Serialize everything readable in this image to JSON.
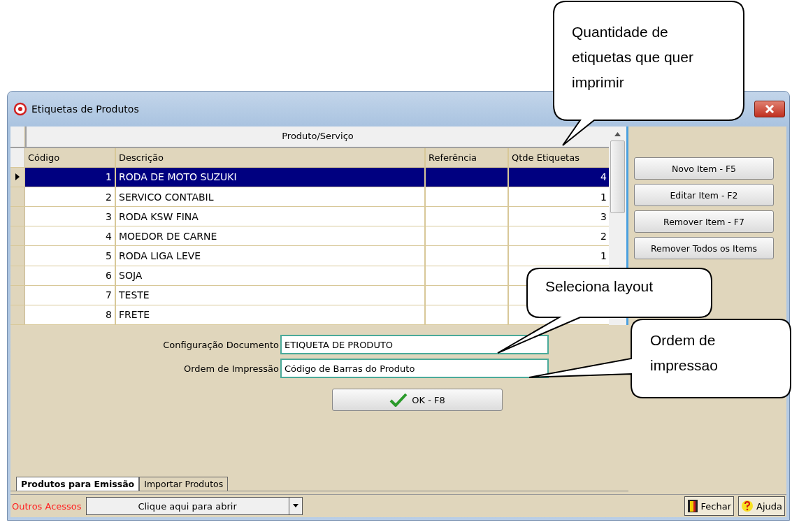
{
  "window": {
    "title": "Etiquetas de Produtos"
  },
  "grid": {
    "group_header": "Produto/Serviço",
    "columns": [
      "Código",
      "Descrição",
      "Referência",
      "Qtde Etiquetas"
    ],
    "rows": [
      {
        "codigo": "1",
        "descricao": "RODA DE MOTO SUZUKI",
        "qtde": "4",
        "selected": true
      },
      {
        "codigo": "2",
        "descricao": "SERVICO CONTABIL",
        "qtde": "1",
        "selected": false
      },
      {
        "codigo": "3",
        "descricao": "RODA KSW FINA",
        "qtde": "3",
        "selected": false
      },
      {
        "codigo": "4",
        "descricao": "MOEDOR DE CARNE",
        "qtde": "2",
        "selected": false
      },
      {
        "codigo": "5",
        "descricao": "RODA LIGA LEVE",
        "qtde": "1",
        "selected": false
      },
      {
        "codigo": "6",
        "descricao": "SOJA",
        "selected": false
      },
      {
        "codigo": "7",
        "descricao": "TESTE",
        "selected": false
      },
      {
        "codigo": "8",
        "descricao": "FRETE",
        "selected": false
      }
    ]
  },
  "side_buttons": [
    "Novo Item - F5",
    "Editar Item - F2",
    "Remover Item - F7",
    "Remover Todos os Items"
  ],
  "fields": [
    {
      "label": "Configuração Documento",
      "value": "ETIQUETA DE PRODUTO"
    },
    {
      "label": "Ordem de Impressão",
      "value": "Código de Barras do Produto"
    }
  ],
  "ok_button": "OK - F8",
  "tabs": [
    {
      "label": "Produtos para Emissão",
      "selected": true
    },
    {
      "label": "Importar Produtos",
      "selected": false
    }
  ],
  "status_bar": {
    "label": "Outros Acessos",
    "dropdown": "Clique aqui para abrir",
    "buttons": [
      {
        "kind": "exit",
        "label": "Fechar"
      },
      {
        "kind": "help",
        "label": "Ajuda"
      }
    ]
  },
  "callouts": [
    "Quantidade de etiquetas que quer imprimir",
    "Seleciona layout",
    "Ordem de impressao"
  ]
}
